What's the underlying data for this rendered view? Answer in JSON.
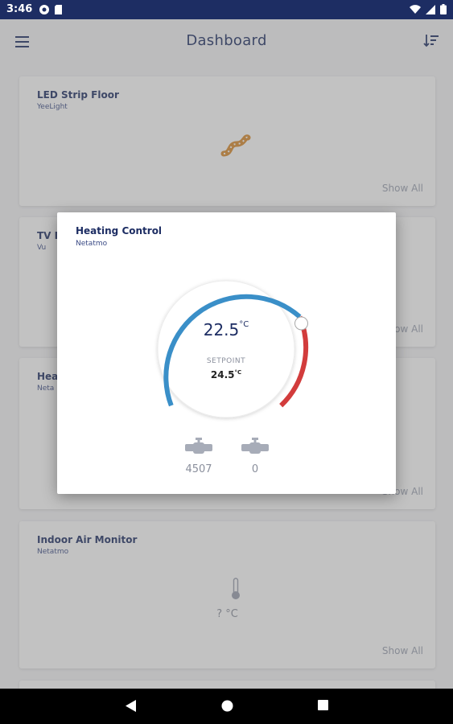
{
  "status_bar": {
    "time": "3:46"
  },
  "app_bar": {
    "title": "Dashboard"
  },
  "cards": [
    {
      "title": "LED Strip Floor",
      "subtitle": "YeeLight",
      "show_all": "Show All"
    },
    {
      "title": "TV R",
      "subtitle": "Vu",
      "show_all": "Show All"
    },
    {
      "title": "Hea",
      "subtitle": "Neta",
      "show_all": "Show All"
    },
    {
      "title": "Indoor Air Monitor",
      "subtitle": "Netatmo",
      "show_all": "Show All",
      "reading": "? °C"
    }
  ],
  "dialog": {
    "title": "Heating Control",
    "subtitle": "Netatmo",
    "current_temp": "22.5",
    "temp_unit": "°C",
    "setpoint_label": "SETPOINT",
    "setpoint_value": "24.5",
    "setpoint_unit": "°C",
    "valves": [
      {
        "icon": "valve-icon",
        "value": "4507"
      },
      {
        "icon": "valve-icon",
        "value": "0"
      }
    ]
  },
  "colors": {
    "primary": "#1d2d63",
    "dial_blue": "#3a8fc8",
    "dial_red": "#d23c3c"
  }
}
